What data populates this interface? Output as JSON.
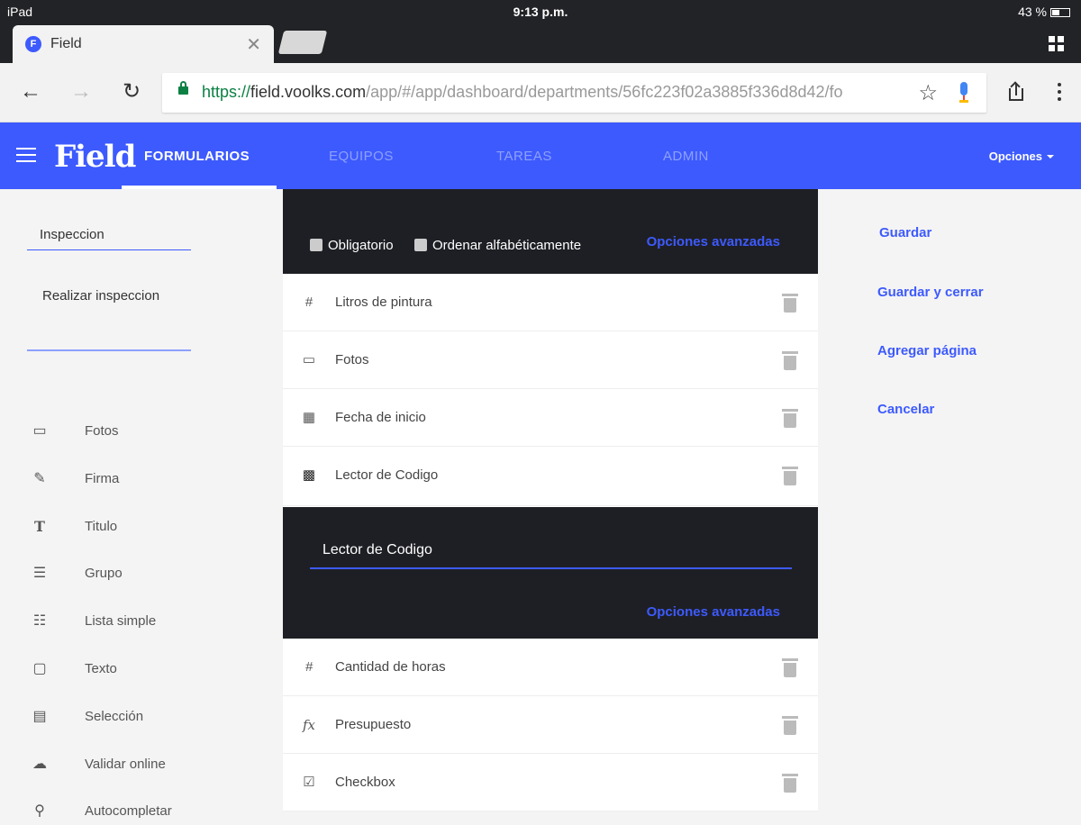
{
  "status_bar": {
    "device": "iPad",
    "time": "9:13 p.m.",
    "battery": "43 %"
  },
  "browser": {
    "tab_title": "Field",
    "url_scheme": "https://",
    "url_host": "field.voolks.com",
    "url_path": "/app/#/app/dashboard/departments/56fc223f02a3885f336d8d42/fo"
  },
  "app": {
    "logo": "Field",
    "nav": [
      "FORMULARIOS",
      "EQUIPOS",
      "TAREAS",
      "ADMIN"
    ],
    "options_label": "Opciones"
  },
  "left_panel": {
    "form_name": "Inspeccion",
    "form_description": "Realizar inspeccion",
    "palette": [
      {
        "icon": "photo-icon",
        "label": "Fotos"
      },
      {
        "icon": "signature-icon",
        "label": "Firma"
      },
      {
        "icon": "title-icon",
        "label": "Titulo"
      },
      {
        "icon": "group-icon",
        "label": "Grupo"
      },
      {
        "icon": "list-icon",
        "label": "Lista simple"
      },
      {
        "icon": "text-icon",
        "label": "Texto"
      },
      {
        "icon": "selection-icon",
        "label": "Selección"
      },
      {
        "icon": "cloud-check-icon",
        "label": "Validar online"
      },
      {
        "icon": "search-icon",
        "label": "Autocompletar"
      }
    ]
  },
  "center_panel": {
    "checkboxes": [
      "Obligatorio",
      "Ordenar alfabéticamente"
    ],
    "advanced_options": "Opciones avanzadas",
    "fields_top": [
      {
        "icon": "number-icon",
        "label": "Litros de pintura"
      },
      {
        "icon": "photo-icon",
        "label": "Fotos"
      },
      {
        "icon": "calendar-icon",
        "label": "Fecha de inicio"
      },
      {
        "icon": "qr-code-icon",
        "label": "Lector de Codigo"
      }
    ],
    "editing_field_value": "Lector de Codigo",
    "fields_bottom": [
      {
        "icon": "number-icon",
        "label": "Cantidad de horas"
      },
      {
        "icon": "formula-icon",
        "label": "Presupuesto"
      },
      {
        "icon": "checkbox-icon",
        "label": "Checkbox"
      }
    ]
  },
  "right_panel": {
    "actions": [
      "Guardar",
      "Guardar y cerrar",
      "Agregar página",
      "Cancelar"
    ]
  }
}
